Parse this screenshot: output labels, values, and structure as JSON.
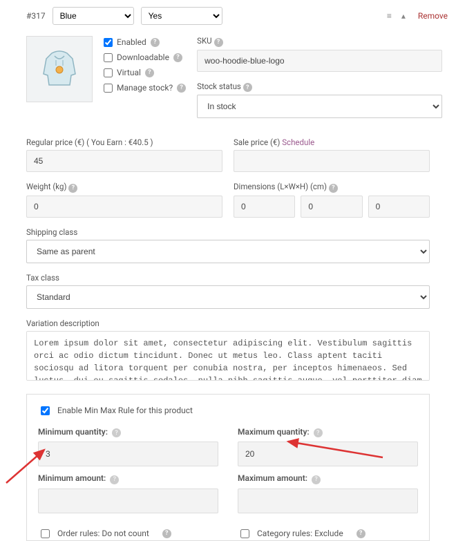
{
  "header": {
    "id_label": "#317",
    "attr1_selected": "Blue",
    "attr2_selected": "Yes",
    "remove_label": "Remove"
  },
  "flags": {
    "enabled_label": "Enabled",
    "downloadable_label": "Downloadable",
    "virtual_label": "Virtual",
    "manage_stock_label": "Manage stock?"
  },
  "sku": {
    "label": "SKU",
    "value": "woo-hoodie-blue-logo"
  },
  "stock_status": {
    "label": "Stock status",
    "selected": "In stock"
  },
  "regular_price": {
    "label": "Regular price (€) ( You Earn : €40.5 )",
    "value": "45"
  },
  "sale_price": {
    "label": "Sale price (€)",
    "schedule_label": "Schedule",
    "value": ""
  },
  "weight": {
    "label": "Weight (kg)",
    "value": "0"
  },
  "dimensions": {
    "label": "Dimensions (L×W×H) (cm)",
    "l": "0",
    "w": "0",
    "h": "0"
  },
  "shipping_class": {
    "label": "Shipping class",
    "selected": "Same as parent"
  },
  "tax_class": {
    "label": "Tax class",
    "selected": "Standard"
  },
  "description": {
    "label": "Variation description",
    "value": "Lorem ipsum dolor sit amet, consectetur adipiscing elit. Vestibulum sagittis orci ac odio dictum tincidunt. Donec ut metus leo. Class aptent taciti sociosqu ad litora torquent per conubia nostra, per inceptos himenaeos. Sed luctus, dui eu sagittis sodales, nulla nibh sagittis augue, vel porttitor diam enim non metus. Vestibulum aliquam augue neque. Phasellus tincidunt odio eget ullamcorper efficitur. Cras placerat ut"
  },
  "minmax": {
    "enable_label": "Enable Min Max Rule for this product",
    "min_qty_label": "Minimum quantity:",
    "max_qty_label": "Maximum quantity:",
    "min_amt_label": "Minimum amount:",
    "max_amt_label": "Maximum amount:",
    "min_qty": "3",
    "max_qty": "20",
    "min_amt": "",
    "max_amt": "",
    "order_rules_label": "Order rules: Do not count",
    "category_rules_label": "Category rules: Exclude"
  }
}
